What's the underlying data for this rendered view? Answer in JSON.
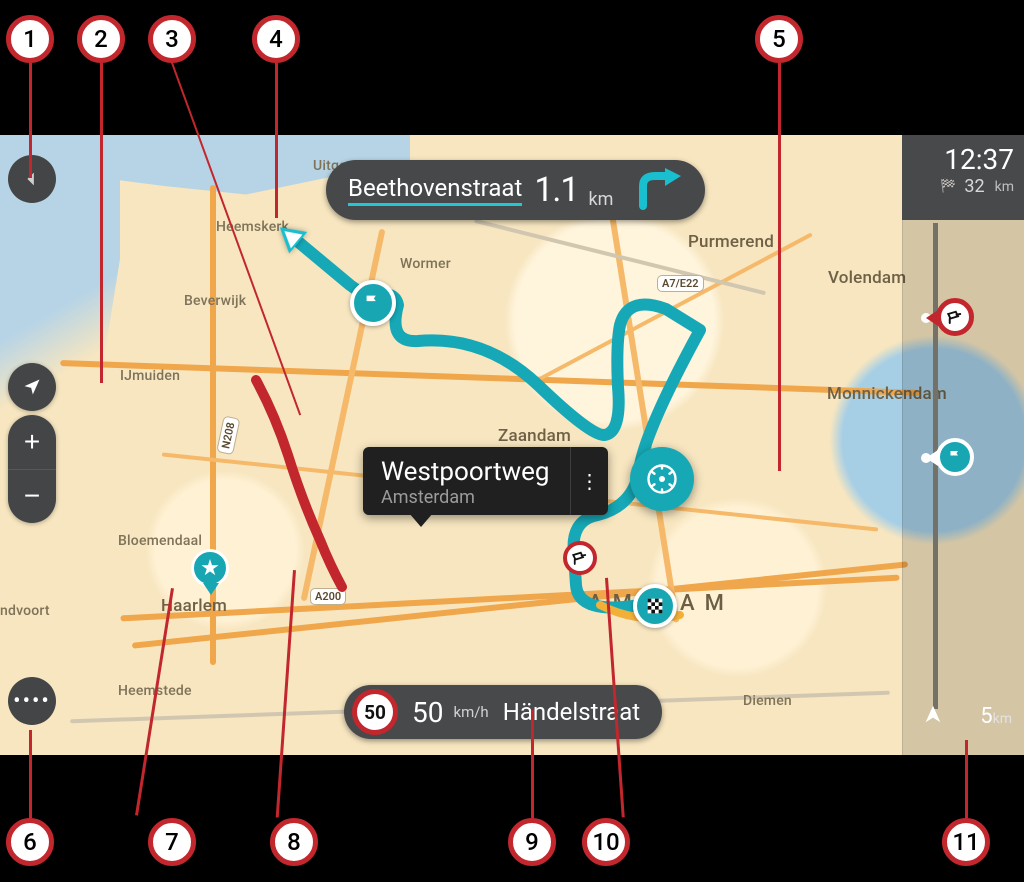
{
  "instruction": {
    "street": "Beethovenstraat",
    "distance": "1.1",
    "unit": "km"
  },
  "selected_location": {
    "title": "Westpoortweg",
    "subtitle": "Amsterdam"
  },
  "status": {
    "clock": "12:37",
    "remaining_distance": "32",
    "remaining_unit": "km",
    "bar_distance": "5",
    "bar_unit": "km"
  },
  "speed": {
    "limit": "50",
    "current": "50",
    "unit": "km/h",
    "street": "Händelstraat"
  },
  "labels": {
    "zoom_in": "+",
    "zoom_out": "−",
    "menu_dots": "••••"
  },
  "roads": {
    "a7": "A7/E22",
    "n208": "N208",
    "a200": "A200"
  },
  "cities": {
    "uitgeest": "Uitgeest",
    "heemskerk": "Heemskerk",
    "beverwijk": "Beverwijk",
    "ijmuiden": "IJmuiden",
    "bloemendaal": "Bloemendaal",
    "zandvoort": "ndvoort",
    "haarlem": "Haarlem",
    "heemstede": "Heemstede",
    "zaandam": "Zaandam",
    "wormer": "Wormer",
    "purmerend": "Purmerend",
    "volendam": "Volendam",
    "monnickendam": "Monnickendam",
    "diemen": "Diemen",
    "amsterdam_left": "AMS",
    "amsterdam_right": "AM"
  },
  "callouts": {
    "c1": "1",
    "c2": "2",
    "c3": "3",
    "c4": "4",
    "c5": "5",
    "c6": "6",
    "c7": "7",
    "c8": "8",
    "c9": "9",
    "c10": "10",
    "c11": "11"
  }
}
